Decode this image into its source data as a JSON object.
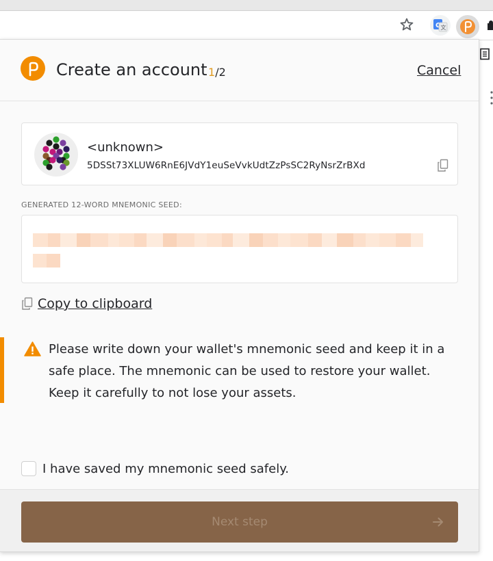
{
  "popup": {
    "title": "Create an account",
    "step_current": "1",
    "step_total": "/2",
    "cancel_label": "Cancel"
  },
  "account": {
    "name": "<unknown>",
    "address": "5DSSt73XLUW6RnE6JVdY1euSeVvkUdtZzPsSC2RyNsrZrBXd"
  },
  "seed": {
    "label": "GENERATED 12-WORD MNEMONIC SEED:",
    "copy_label": "Copy to clipboard"
  },
  "warning": {
    "text": "Please write down your wallet's mnemonic seed and keep it in a safe place. The mnemonic can be used to restore your wallet. Keep it carefully to not lose your assets."
  },
  "confirm": {
    "checkbox_label": "I have saved my mnemonic seed safely.",
    "checked": false
  },
  "footer": {
    "next_label": "Next step",
    "next_enabled": false
  },
  "colors": {
    "accent": "#e6007a",
    "brand_orange": "#f28c00",
    "step_highlight": "#e09b22",
    "button_bg": "#866448",
    "button_text_disabled": "#a58a72",
    "warning_bar": "#f28c00"
  },
  "icons": {
    "star": "star-icon",
    "translate": "google-translate-icon",
    "extension": "polkadot-extension-icon",
    "logo": "polkadot-logo-icon",
    "copy": "copy-icon",
    "warning": "warning-triangle-icon",
    "arrow": "arrow-right-icon"
  }
}
